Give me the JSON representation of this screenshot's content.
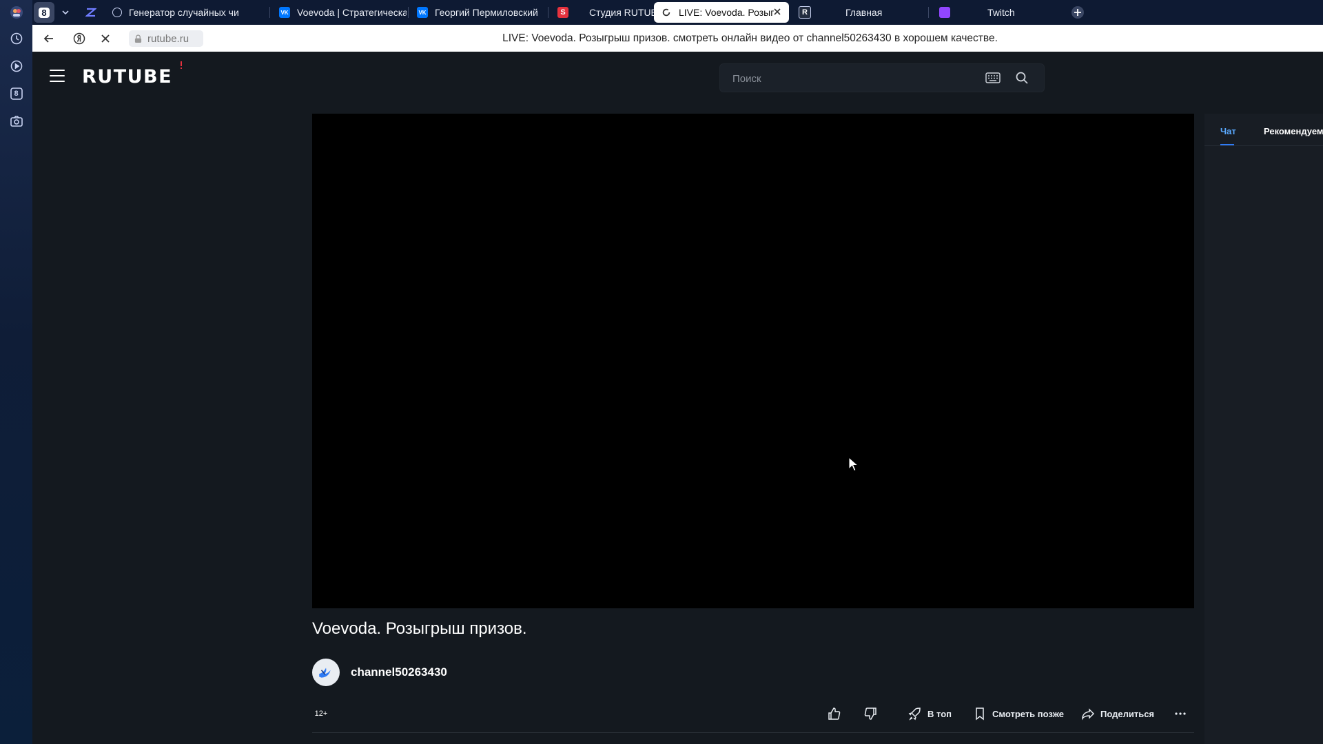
{
  "browser": {
    "sidebar_badge": "8",
    "tab_counter": "8",
    "tabs": [
      {
        "label": "Генератор случайных чи",
        "fav_color": "#5a6aa8"
      },
      {
        "label": "Voevoda | Стратегическая",
        "fav_color": "#0077ff",
        "fav_text": "VK"
      },
      {
        "label": "Георгий Пермиловский",
        "fav_color": "#0077ff",
        "fav_text": "VK"
      },
      {
        "label": "Студия RUTUBE",
        "fav_color": "#e6323e",
        "fav_text": "S"
      },
      {
        "label": "LIVE: Voevoda. Розыгр",
        "active": true
      },
      {
        "label": "Главная",
        "fav_text": "R"
      },
      {
        "label": "Twitch",
        "fav_color": "#9146ff"
      }
    ],
    "address": {
      "url": "rutube.ru",
      "page_title": "LIVE: Voevoda. Розыгрыш призов. смотреть онлайн видео от channel50263430 в хорошем качестве."
    }
  },
  "site": {
    "logo": "RUTUBE",
    "search_placeholder": "Поиск"
  },
  "video": {
    "title": "Voevoda. Розыгрыш призов.",
    "channel": "channel50263430",
    "age_rating": "12+",
    "actions": {
      "top": "В топ",
      "watch_later": "Смотреть позже",
      "share": "Поделиться"
    }
  },
  "right_panel": {
    "tabs": [
      "Чат",
      "Рекомендуем"
    ],
    "active_tab": "Чат"
  },
  "colors": {
    "page_bg": "#14191f",
    "accent": "#2f7bf5",
    "brand_red": "#e6323e"
  }
}
